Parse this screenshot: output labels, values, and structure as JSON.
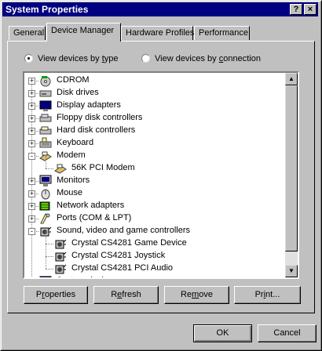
{
  "window": {
    "title": "System Properties",
    "help_btn": "?",
    "close_btn": "×"
  },
  "tabs": [
    {
      "label": "General",
      "active": false
    },
    {
      "label": "Device Manager",
      "active": true
    },
    {
      "label": "Hardware Profiles",
      "active": false
    },
    {
      "label": "Performance",
      "active": false
    }
  ],
  "view_options": {
    "by_type": {
      "pre": "View devices by ",
      "ul": "t",
      "post": "ype",
      "selected": true
    },
    "by_connection": {
      "pre": "View devices by ",
      "ul": "c",
      "post": "onnection",
      "selected": false
    }
  },
  "tree": [
    {
      "label": "CDROM",
      "level": 0,
      "expander": "+",
      "icon": "cdrom-icon"
    },
    {
      "label": "Disk drives",
      "level": 0,
      "expander": "+",
      "icon": "disk-drive-icon"
    },
    {
      "label": "Display adapters",
      "level": 0,
      "expander": "+",
      "icon": "display-adapter-icon"
    },
    {
      "label": "Floppy disk controllers",
      "level": 0,
      "expander": "+",
      "icon": "floppy-controller-icon"
    },
    {
      "label": "Hard disk controllers",
      "level": 0,
      "expander": "+",
      "icon": "hard-disk-controller-icon"
    },
    {
      "label": "Keyboard",
      "level": 0,
      "expander": "+",
      "icon": "keyboard-icon"
    },
    {
      "label": "Modem",
      "level": 0,
      "expander": "-",
      "icon": "modem-icon"
    },
    {
      "label": "56K PCI Modem",
      "level": 1,
      "expander": "",
      "icon": "modem-icon"
    },
    {
      "label": "Monitors",
      "level": 0,
      "expander": "+",
      "icon": "monitor-icon"
    },
    {
      "label": "Mouse",
      "level": 0,
      "expander": "+",
      "icon": "mouse-icon"
    },
    {
      "label": "Network adapters",
      "level": 0,
      "expander": "+",
      "icon": "network-adapter-icon"
    },
    {
      "label": "Ports (COM & LPT)",
      "level": 0,
      "expander": "+",
      "icon": "port-icon"
    },
    {
      "label": "Sound, video and game controllers",
      "level": 0,
      "expander": "-",
      "icon": "sound-controller-icon"
    },
    {
      "label": "Crystal CS4281 Game Device",
      "level": 1,
      "expander": "",
      "icon": "sound-controller-icon"
    },
    {
      "label": "Crystal CS4281 Joystick",
      "level": 1,
      "expander": "",
      "icon": "sound-controller-icon"
    },
    {
      "label": "Crystal CS4281 PCI Audio",
      "level": 1,
      "expander": "",
      "icon": "sound-controller-icon"
    },
    {
      "label": "System devices",
      "level": 0,
      "expander": "+",
      "icon": "system-device-icon"
    }
  ],
  "actions": [
    {
      "pre": "P",
      "ul": "r",
      "post": "operties"
    },
    {
      "pre": "R",
      "ul": "e",
      "post": "fresh"
    },
    {
      "pre": "Re",
      "ul": "m",
      "post": "ove"
    },
    {
      "pre": "Pr",
      "ul": "i",
      "post": "nt..."
    }
  ],
  "dialog_buttons": {
    "ok": "OK",
    "cancel": "Cancel"
  },
  "colors": {
    "title_bar": "#000080",
    "face": "#c0c0c0",
    "window": "#ffffff"
  }
}
